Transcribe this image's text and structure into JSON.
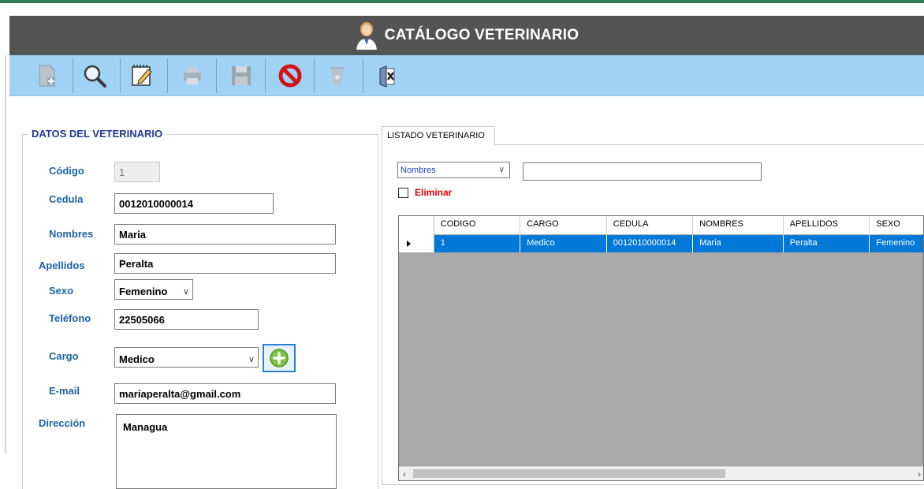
{
  "window": {
    "title": "CATÁLOGO VETERINARIO"
  },
  "toolbar": {
    "buttons": [
      "new-record-icon",
      "search-icon",
      "edit-icon",
      "print-icon",
      "save-icon",
      "cancel-icon",
      "delete-icon",
      "exit-icon"
    ]
  },
  "form": {
    "group_title": "DATOS DEL VETERINARIO",
    "codigo": {
      "label": "Código",
      "value": "1"
    },
    "cedula": {
      "label": "Cedula",
      "value": "0012010000014"
    },
    "nombres": {
      "label": "Nombres",
      "value": "Maria"
    },
    "apellidos": {
      "label": "Apellidos",
      "value": "Peralta"
    },
    "sexo": {
      "label": "Sexo",
      "value": "Femenino"
    },
    "telefono": {
      "label": "Teléfono",
      "value": "22505066"
    },
    "cargo": {
      "label": "Cargo",
      "value": "Medico"
    },
    "email": {
      "label": "E-mail",
      "value": "mariaperalta@gmail.com"
    },
    "direccion": {
      "label": "Dirección",
      "value": "Managua"
    }
  },
  "listado": {
    "tab_label": "LISTADO VETERINARIO",
    "search_field": "Nombres",
    "search_value": "",
    "eliminar_label": "Eliminar",
    "columns": [
      "CODIGO",
      "CARGO",
      "CEDULA",
      "NOMBRES",
      "APELLIDOS",
      "SEXO"
    ],
    "rows": [
      [
        "1",
        "Medico",
        "0012010000014",
        "Maria",
        "Peralta",
        "Femenino"
      ]
    ]
  },
  "colors": {
    "title_bar": "#545454",
    "toolbar": "#9fd2f5",
    "label_blue": "#1e63a8",
    "selection": "#0078d7",
    "eliminar_red": "#e00000"
  }
}
